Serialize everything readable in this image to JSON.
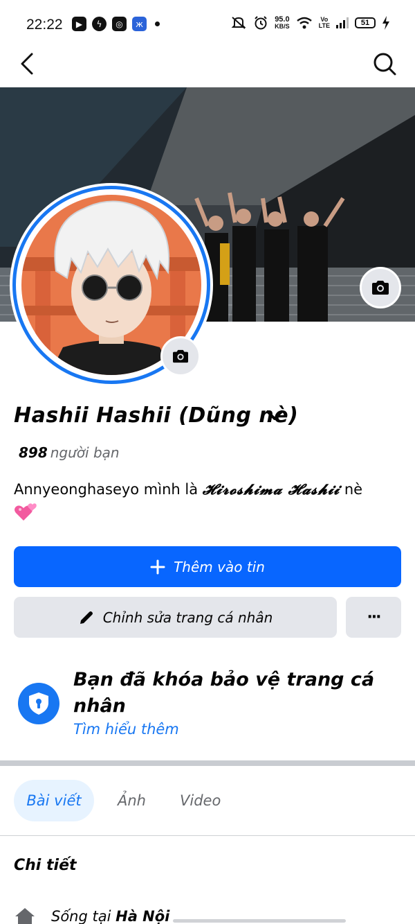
{
  "status_bar": {
    "time": "22:22",
    "net_speed_value": "95.0",
    "net_speed_unit": "KB/S",
    "volte_top": "Vo",
    "volte_bottom": "LTE",
    "battery": "51"
  },
  "profile": {
    "name": "Hashii Hashii (Dũng nè)",
    "friends_count": "898",
    "friends_label": "người bạn",
    "bio_text": "Annyeonghaseyo mình là",
    "bio_fancy": "𝓗𝓲𝓻𝓸𝓼𝓱𝓲𝓶𝓪 𝓗𝓪𝓼𝓱𝓲𝓲",
    "bio_suffix": "nè"
  },
  "actions": {
    "add_story_label": "Thêm vào tin",
    "edit_profile_label": "Chỉnh sửa trang cá nhân",
    "more_label": "···"
  },
  "lock_notice": {
    "title": "Bạn đã khóa bảo vệ trang cá nhân",
    "link": "Tìm hiểu thêm"
  },
  "tabs": [
    {
      "label": "Bài viết",
      "active": true
    },
    {
      "label": "Ảnh",
      "active": false
    },
    {
      "label": "Video",
      "active": false
    }
  ],
  "details": {
    "title": "Chi tiết",
    "lives_in_prefix": "Sống tại",
    "lives_in_city": "Hà Nội"
  },
  "colors": {
    "accent": "#1877f2",
    "primary_button": "#0866ff",
    "secondary_button": "#e4e6eb",
    "muted_text": "#65676b"
  },
  "icons": {
    "back": "chevron-left-icon",
    "search": "search-icon",
    "camera": "camera-icon",
    "plus": "plus-icon",
    "pencil": "pencil-icon",
    "shield": "shield-lock-icon",
    "home": "home-icon"
  }
}
